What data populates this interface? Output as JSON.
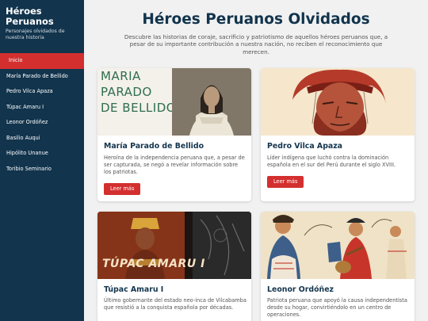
{
  "sidebar": {
    "title": "Héroes Peruanos",
    "subtitle": "Personajes olvidados de nuestra historia",
    "items": [
      {
        "label": "Inicio"
      },
      {
        "label": "María Parado de Bellido"
      },
      {
        "label": "Pedro Vilca Apaza"
      },
      {
        "label": "Túpac Amaru I"
      },
      {
        "label": "Leonor Ordóñez"
      },
      {
        "label": "Basilio Auqui"
      },
      {
        "label": "Hipólito Unanue"
      },
      {
        "label": "Toribio Seminario"
      }
    ]
  },
  "main": {
    "title": "Héroes Peruanos Olvidados",
    "intro": "Descubre las historias de coraje, sacrificio y patriotismo de aquellos héroes peruanos que, a pesar de su importante contribución a nuestra nación, no reciben el reconocimiento que merecen.",
    "cards": [
      {
        "name": "María Parado de Bellido",
        "description": "Heroína de la independencia peruana que, a pesar de ser capturada, se negó a revelar información sobre los patriotas.",
        "button": "Leer más",
        "image_text_1": "MARIA",
        "image_text_2": "PARADO",
        "image_text_3": "DE BELLIDO"
      },
      {
        "name": "Pedro Vilca Apaza",
        "description": "Líder indígena que luchó contra la dominación española en el sur del Perú durante el siglo XVIII.",
        "button": "Leer más"
      },
      {
        "name": "Túpac Amaru I",
        "description": "Último gobernante del estado neo-inca de Vilcabamba que resistió a la conquista española por décadas.",
        "image_text": "TÚPAC AMARU I"
      },
      {
        "name": "Leonor Ordóñez",
        "description": "Patriota peruana que apoyó la causa independentista desde su hogar, convirtiéndolo en un centro de operaciones."
      }
    ]
  },
  "colors": {
    "sidebar_bg": "#12344d",
    "accent": "#d32f2f",
    "title": "#12344d"
  }
}
